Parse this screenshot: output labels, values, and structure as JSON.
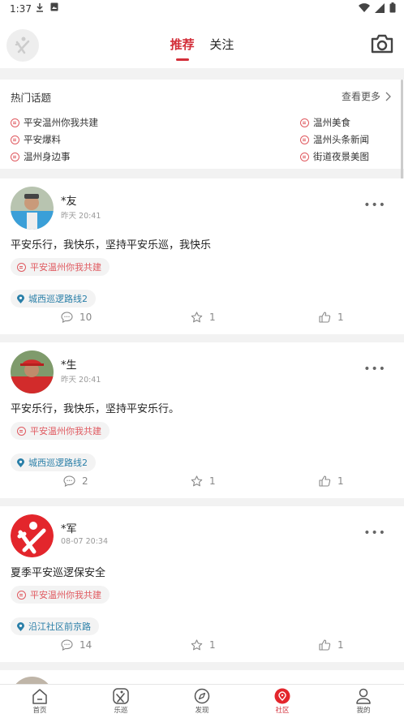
{
  "status_bar": {
    "time": "1:37"
  },
  "header": {
    "tabs": [
      {
        "label": "推荐",
        "active": true
      },
      {
        "label": "关注",
        "active": false
      }
    ],
    "accent_color": "#d32f3a"
  },
  "topics": {
    "title": "热门话题",
    "more_label": "查看更多",
    "left": [
      "平安温州你我共建",
      "平安爆料",
      "温州身边事"
    ],
    "right": [
      "温州美食",
      "温州头条新闻",
      "街道夜景美图"
    ]
  },
  "posts": [
    {
      "author": "*友",
      "time": "昨天 20:41",
      "content": "平安乐行，我快乐，坚持平安乐巡，我快乐",
      "topic": "平安温州你我共建",
      "location": "城西巡逻路线2",
      "comments": "10",
      "favorites": "1",
      "likes": "1",
      "avatar": "person-blue-vest"
    },
    {
      "author": "*生",
      "time": "昨天 20:41",
      "content": "平安乐行，我快乐，坚持平安乐行。",
      "topic": "平安温州你我共建",
      "location": "城西巡逻路线2",
      "comments": "2",
      "favorites": "1",
      "likes": "1",
      "avatar": "person-red-cap"
    },
    {
      "author": "*军",
      "time": "08-07 20:34",
      "content": "夏季平安巡逻保安全",
      "topic": "平安温州你我共建",
      "location": "沿江社区前京路",
      "comments": "14",
      "favorites": "1",
      "likes": "1",
      "avatar": "red-logo"
    }
  ],
  "tabbar": {
    "items": [
      {
        "label": "首页",
        "icon": "home-icon",
        "active": false
      },
      {
        "label": "乐巡",
        "icon": "patrol-icon",
        "active": false
      },
      {
        "label": "发现",
        "icon": "compass-icon",
        "active": false
      },
      {
        "label": "社区",
        "icon": "community-icon",
        "active": true
      },
      {
        "label": "我的",
        "icon": "profile-icon",
        "active": false
      }
    ]
  }
}
